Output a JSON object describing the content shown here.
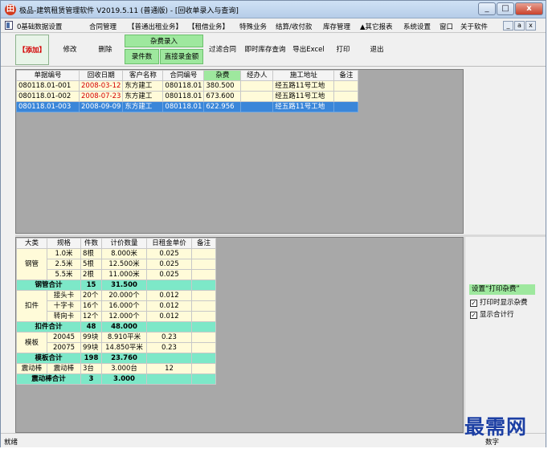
{
  "window": {
    "title": "极品-建筑租赁管理软件 V2019.5.11 (普通版) - [回收单录入与查询]",
    "minimize": "_",
    "maximize": "□",
    "close": "x"
  },
  "menubar": {
    "items": [
      "0基础数据设置",
      "合同管理",
      "【普通出租业务】",
      "【租借业务】",
      "特殊业务",
      "结算/收付款",
      "库存管理",
      "▲其它报表",
      "系统设置",
      "窗口",
      "关于软件"
    ],
    "mdi_buttons": [
      "_",
      "a",
      "x"
    ]
  },
  "toolbar": {
    "add": "【添加】",
    "edit": "修改",
    "delete": "删除",
    "group_title": "杂费录入",
    "entry_count": "录件数",
    "entry_amount": "直接录金额",
    "filter_contract": "过滤合同",
    "instant_stock": "即时库存查询",
    "export_excel": "导出Excel",
    "print": "打印",
    "exit": "退出"
  },
  "receipts": {
    "columns": [
      "单据编号",
      "回收日期",
      "客户名称",
      "合同编号",
      "杂费",
      "经办人",
      "施工地址",
      "备注"
    ],
    "rows": [
      {
        "id": "080118.01-001",
        "date": "2008-03-12",
        "client": "东方建工",
        "contract": "080118.01",
        "fee": "380.500",
        "handler": "",
        "address": "经五路11号工地",
        "note": ""
      },
      {
        "id": "080118.01-002",
        "date": "2008-07-23",
        "client": "东方建工",
        "contract": "080118.01",
        "fee": "673.600",
        "handler": "",
        "address": "经五路11号工地",
        "note": ""
      },
      {
        "id": "080118.01-003",
        "date": "2008-09-09",
        "client": "东方建工",
        "contract": "080118.01",
        "fee": "622.956",
        "handler": "",
        "address": "经五路11号工地",
        "note": ""
      }
    ],
    "selected_row": 2
  },
  "details": {
    "columns": [
      "大类",
      "规格",
      "件数",
      "计价数量",
      "日租金单价",
      "备注"
    ],
    "groups": [
      {
        "category": "钢管",
        "rows": [
          {
            "spec": "1.0米",
            "count": "8根",
            "qty": "8.000米",
            "price": "0.025",
            "note": ""
          },
          {
            "spec": "2.5米",
            "count": "5根",
            "qty": "12.500米",
            "price": "0.025",
            "note": ""
          },
          {
            "spec": "5.5米",
            "count": "2根",
            "qty": "11.000米",
            "price": "0.025",
            "note": ""
          }
        ],
        "subtotal": {
          "label": "钢管合计",
          "count": "15",
          "qty": "31.500"
        }
      },
      {
        "category": "扣件",
        "rows": [
          {
            "spec": "接头卡",
            "count": "20个",
            "qty": "20.000个",
            "price": "0.012",
            "note": ""
          },
          {
            "spec": "十字卡",
            "count": "16个",
            "qty": "16.000个",
            "price": "0.012",
            "note": ""
          },
          {
            "spec": "转向卡",
            "count": "12个",
            "qty": "12.000个",
            "price": "0.012",
            "note": ""
          }
        ],
        "subtotal": {
          "label": "扣件合计",
          "count": "48",
          "qty": "48.000"
        }
      },
      {
        "category": "模板",
        "rows": [
          {
            "spec": "20045",
            "count": "99块",
            "qty": "8.910平米",
            "price": "0.23",
            "note": ""
          },
          {
            "spec": "20075",
            "count": "99块",
            "qty": "14.850平米",
            "price": "0.23",
            "note": ""
          }
        ],
        "subtotal": {
          "label": "模板合计",
          "count": "198",
          "qty": "23.760"
        }
      },
      {
        "category": "震动棒",
        "rows": [
          {
            "spec": "震动棒",
            "count": "3台",
            "qty": "3.000台",
            "price": "12",
            "note": ""
          }
        ],
        "subtotal": {
          "label": "震动棒合计",
          "count": "3",
          "qty": "3.000"
        }
      }
    ]
  },
  "side_panel": {
    "title": "设置“打印杂费”",
    "options": [
      {
        "label": "打印时显示杂费",
        "checked": true
      },
      {
        "label": "显示合计行",
        "checked": true
      }
    ]
  },
  "status": {
    "text": "就绪",
    "numlock": "数字"
  },
  "watermark": "最需网"
}
